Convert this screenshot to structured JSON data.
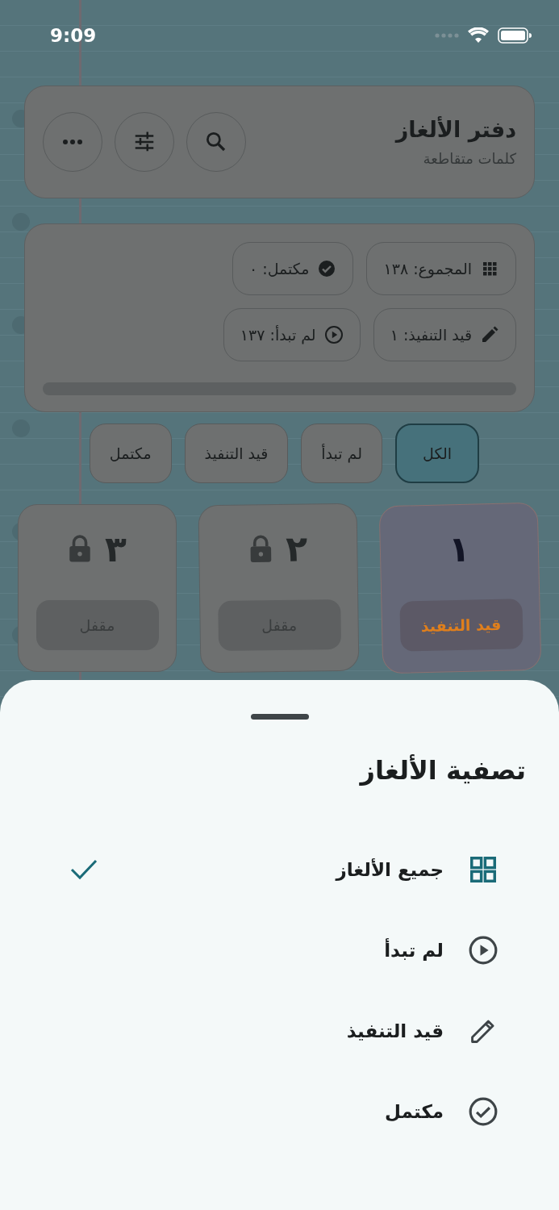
{
  "status_bar": {
    "time": "9:09"
  },
  "header": {
    "title": "دفتر الألغاز",
    "subtitle": "كلمات متقاطعة"
  },
  "stats": {
    "chips": [
      {
        "kind": "total",
        "label": "المجموع: ١٣٨"
      },
      {
        "kind": "completed",
        "label": "مكتمل: ٠"
      },
      {
        "kind": "in_progress",
        "label": "قيد التنفيذ: ١"
      },
      {
        "kind": "not_started",
        "label": "لم تبدأ: ١٣٧"
      }
    ],
    "level": 0
  },
  "filter_tabs": [
    {
      "label": "الكل",
      "selected": true
    },
    {
      "label": "لم تبدأ",
      "selected": false
    },
    {
      "label": "قيد التنفيذ",
      "selected": false
    },
    {
      "label": "مكتمل",
      "selected": false
    }
  ],
  "puzzles": [
    {
      "number": "١",
      "status": "قيد التنفيذ",
      "kind": "in_progress"
    },
    {
      "number": "٢",
      "status": "مقفل",
      "kind": "locked"
    },
    {
      "number": "٣",
      "status": "مقفل",
      "kind": "locked"
    }
  ],
  "sheet": {
    "title": "تصفية الألغاز",
    "options": [
      {
        "kind": "all",
        "label": "جميع الألغاز",
        "selected": true
      },
      {
        "kind": "not_started",
        "label": "لم تبدأ",
        "selected": false
      },
      {
        "kind": "in_progress",
        "label": "قيد التنفيذ",
        "selected": false
      },
      {
        "kind": "completed",
        "label": "مكتمل",
        "selected": false
      }
    ]
  }
}
